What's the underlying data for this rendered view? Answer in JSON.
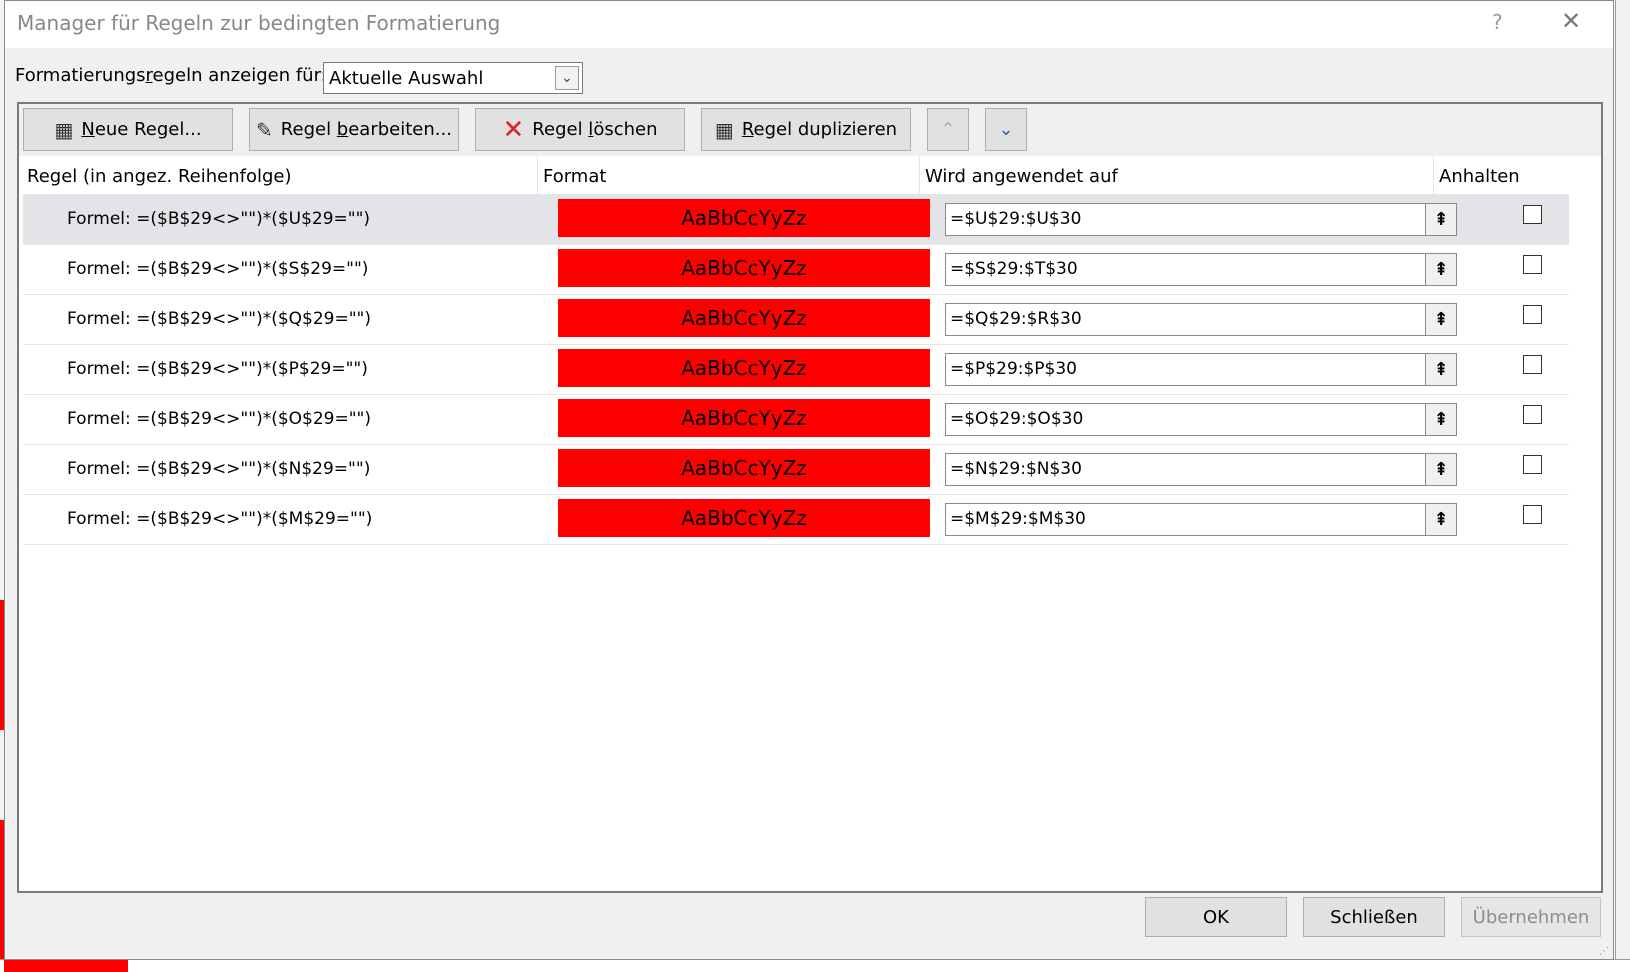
{
  "dialog": {
    "title": "Manager für Regeln zur bedingten Formatierung",
    "help": "?",
    "close": "✕"
  },
  "show_for": {
    "label_pre": "Formatierungs",
    "label_u": "r",
    "label_post": "egeln anzeigen für:",
    "value": "Aktuelle Auswahl"
  },
  "toolbar": {
    "new_rule": {
      "pre": "",
      "u": "N",
      "post": "eue Regel..."
    },
    "edit_rule": {
      "pre": "Regel ",
      "u": "b",
      "post": "earbeiten..."
    },
    "delete_rule": {
      "pre": "Regel ",
      "u": "l",
      "post": "öschen"
    },
    "duplicate_rule": {
      "pre": "",
      "u": "R",
      "post": "egel duplizieren"
    },
    "move_up": "⌃",
    "move_down": "⌄"
  },
  "columns": {
    "rule": "Regel (in angez. Reihenfolge)",
    "format": "Format",
    "applies_to": "Wird angewendet auf",
    "stop": "Anhalten"
  },
  "rules": [
    {
      "rule": "Formel: =($B$29<>\"\")*($U$29=\"\")",
      "preview": "AaBbCcYyZz",
      "applies_to": "=$U$29:$U$30"
    },
    {
      "rule": "Formel: =($B$29<>\"\")*($S$29=\"\")",
      "preview": "AaBbCcYyZz",
      "applies_to": "=$S$29:$T$30"
    },
    {
      "rule": "Formel: =($B$29<>\"\")*($Q$29=\"\")",
      "preview": "AaBbCcYyZz",
      "applies_to": "=$Q$29:$R$30"
    },
    {
      "rule": "Formel: =($B$29<>\"\")*($P$29=\"\")",
      "preview": "AaBbCcYyZz",
      "applies_to": "=$P$29:$P$30"
    },
    {
      "rule": "Formel: =($B$29<>\"\")*($O$29=\"\")",
      "preview": "AaBbCcYyZz",
      "applies_to": "=$O$29:$O$30"
    },
    {
      "rule": "Formel: =($B$29<>\"\")*($N$29=\"\")",
      "preview": "AaBbCcYyZz",
      "applies_to": "=$N$29:$N$30"
    },
    {
      "rule": "Formel: =($B$29<>\"\")*($M$29=\"\")",
      "preview": "AaBbCcYyZz",
      "applies_to": "=$M$29:$M$30"
    }
  ],
  "footer": {
    "ok": "OK",
    "close": "Schließen",
    "apply": "Übernehmen"
  },
  "colors": {
    "format_fill": "#ff0000",
    "selected_row": "#e4e4e8"
  }
}
